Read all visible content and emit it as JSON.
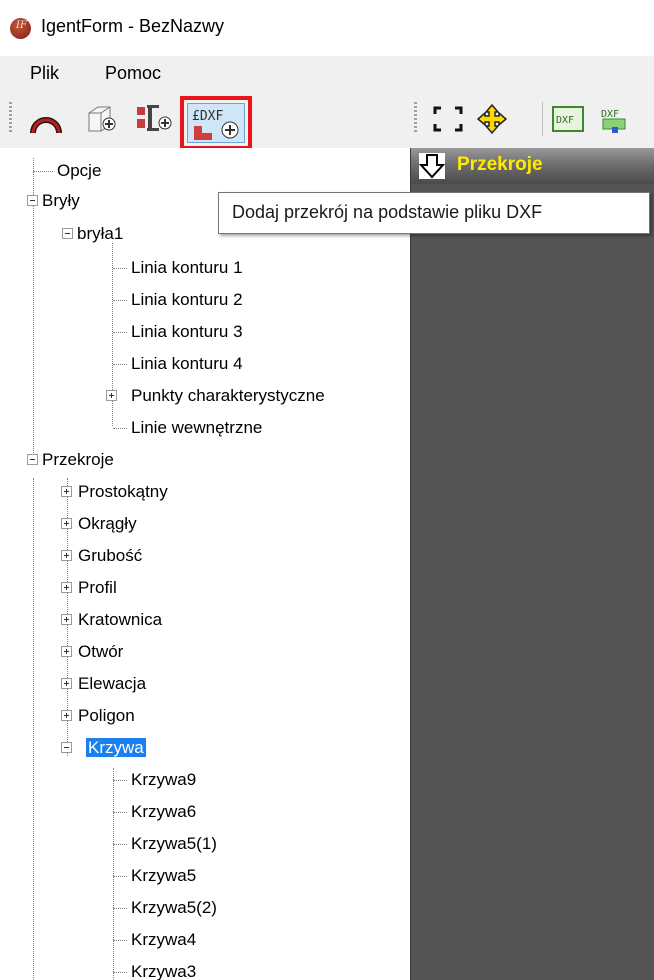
{
  "window": {
    "title": "IgentForm - BezNazwy",
    "icon": "app-logo-icon"
  },
  "menu": {
    "items": [
      "Plik",
      "Pomoc"
    ]
  },
  "toolbar": {
    "left_group": [
      "arc-icon",
      "add-solid-icon",
      "add-beam-icon",
      "add-dxf-section-icon"
    ],
    "right_group": [
      "zoom-extents-icon",
      "pan-icon",
      "dxf-icon",
      "dxf-export-icon"
    ],
    "highlighted": "add-dxf-section-icon",
    "highlight_color": "#e8141c"
  },
  "tooltip": {
    "text": "Dodaj przekrój na podstawie pliku DXF"
  },
  "tree": {
    "opcje": "Opcje",
    "bryly": "Bryły",
    "bryla1": "bryła1",
    "bryla1_children": [
      "Linia konturu 1",
      "Linia konturu 2",
      "Linia konturu 3",
      "Linia konturu 4",
      "Punkty charakterystyczne",
      "Linie wewnętrzne"
    ],
    "przekroje": "Przekroje",
    "przekroje_children": [
      "Prostokątny",
      "Okrągły",
      "Grubość",
      "Profil",
      "Kratownica",
      "Otwór",
      "Elewacja",
      "Poligon",
      "Krzywa"
    ],
    "krzywa_children": [
      "Krzywa9",
      "Krzywa6",
      "Krzywa5(1)",
      "Krzywa5",
      "Krzywa5(2)",
      "Krzywa4",
      "Krzywa3"
    ],
    "selected": "Krzywa",
    "selection_color": "#1a80f0"
  },
  "right_panel": {
    "title": "Przekroje",
    "title_color": "#ffea00",
    "background": "#555555"
  }
}
